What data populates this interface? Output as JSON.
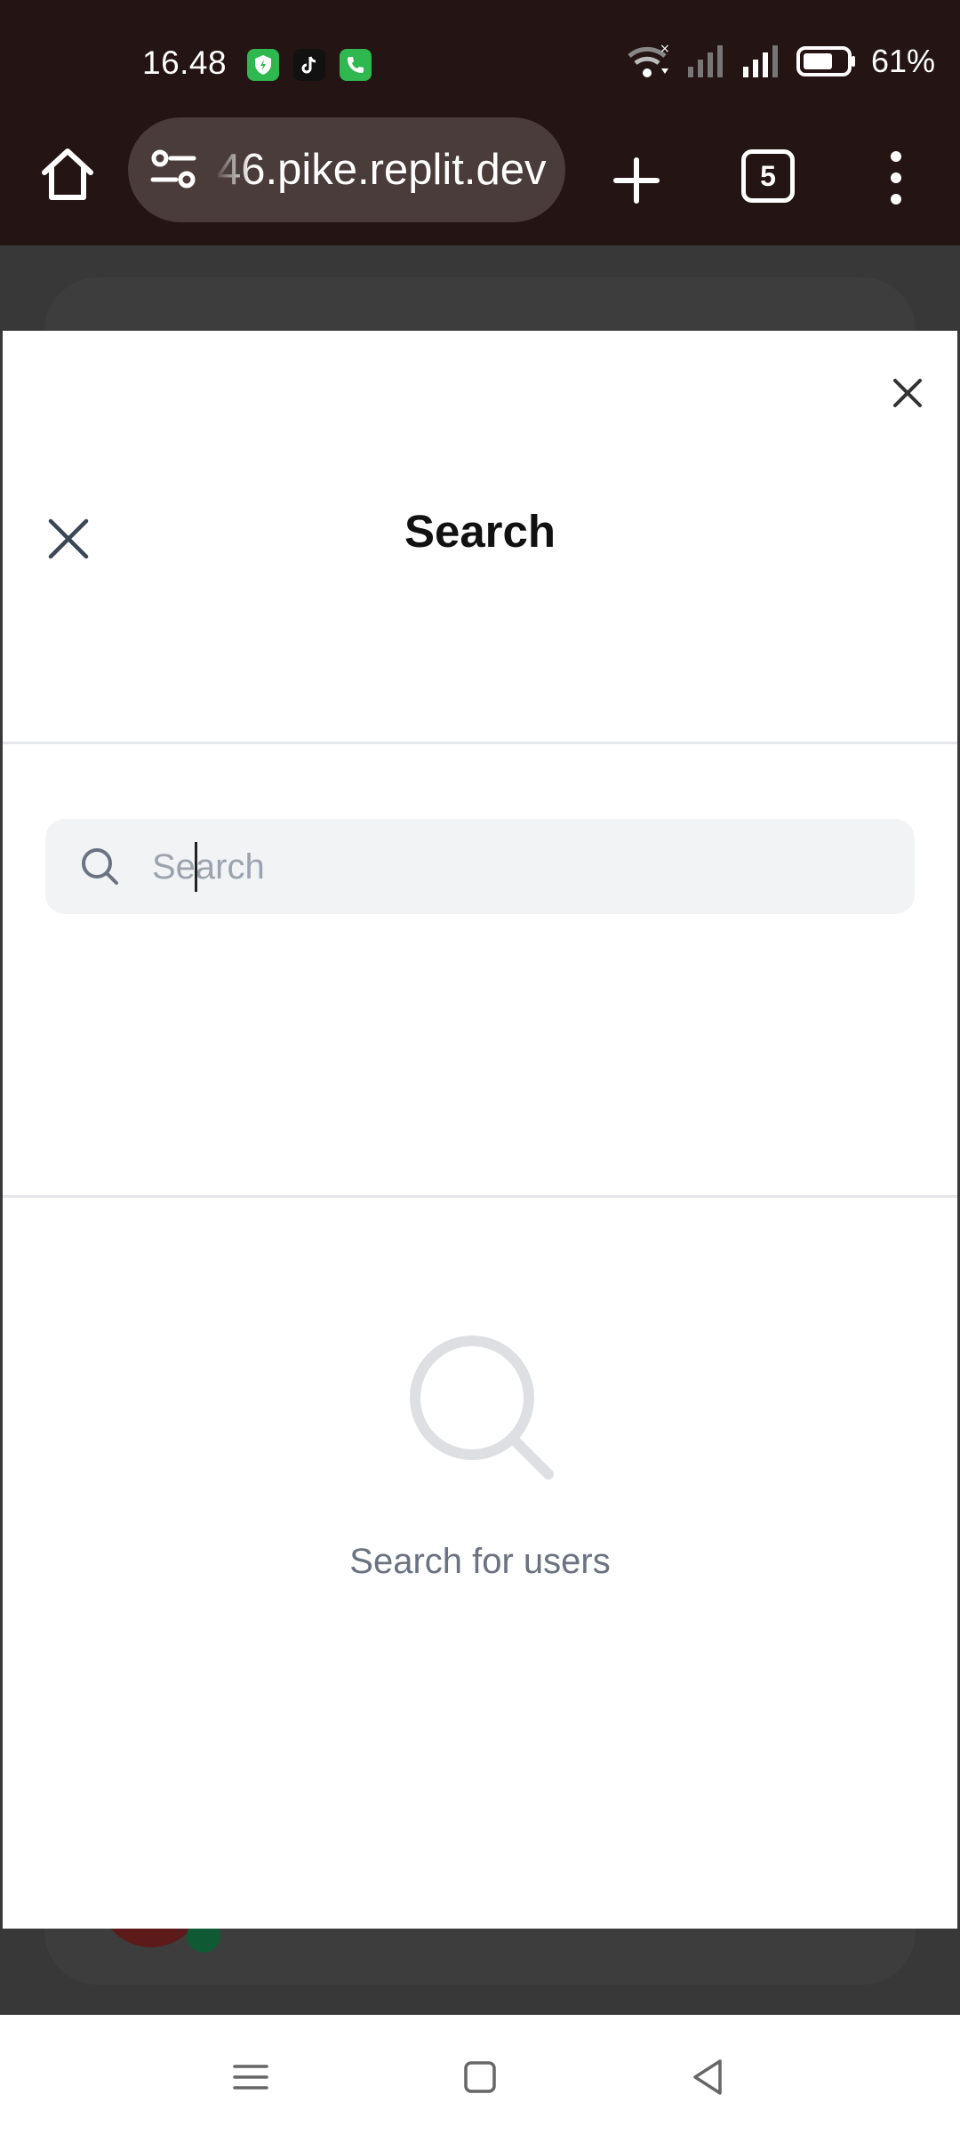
{
  "status_bar": {
    "time": "16.48",
    "battery": "61%",
    "colors": {
      "shield_app": "#2fb84f",
      "tiktok_app": "#111111",
      "phone_app": "#2fb84f"
    }
  },
  "browser": {
    "url": "46.pike.replit.dev",
    "tab_count": "5",
    "icons": [
      "home-icon",
      "tune-icon",
      "plus-icon",
      "tabs-icon",
      "more-vert-icon"
    ]
  },
  "modal": {
    "title": "Search",
    "search_placeholder": "Search",
    "empty_state_text": "Search for users"
  },
  "nav_bar": {
    "icons": [
      "menu-icon",
      "home-square-icon",
      "back-triangle-icon"
    ]
  }
}
